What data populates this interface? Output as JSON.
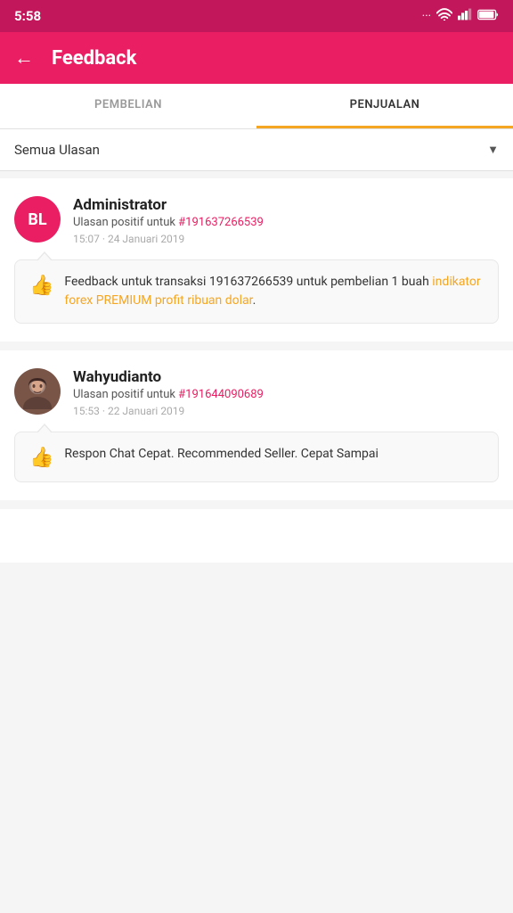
{
  "statusBar": {
    "time": "5:58",
    "icons": [
      "···",
      "wifi",
      "signal",
      "battery"
    ]
  },
  "header": {
    "backLabel": "←",
    "title": "Feedback"
  },
  "tabs": [
    {
      "id": "pembelian",
      "label": "PEMBELIAN",
      "active": false
    },
    {
      "id": "penjualan",
      "label": "PENJUALAN",
      "active": true
    }
  ],
  "filter": {
    "label": "Semua Ulasan",
    "arrowSymbol": "▼"
  },
  "feedbacks": [
    {
      "id": 1,
      "avatarType": "initials",
      "avatarText": "BL",
      "avatarBg": "#e91e63",
      "name": "Administrator",
      "subPrefix": "Ulasan positif untuk ",
      "orderLink": "#191637266539",
      "time": "15:07 · 24 Januari 2019",
      "comment": "Feedback untuk transaksi 191637266539 untuk pembelian 1 buah ",
      "commentLink": "indikator forex PREMIUM profit ribuan dolar",
      "commentSuffix": "."
    },
    {
      "id": 2,
      "avatarType": "photo",
      "avatarText": "",
      "avatarBg": "#795548",
      "name": "Wahyudianto",
      "subPrefix": "Ulasan positif untuk ",
      "orderLink": "#191644090689",
      "time": "15:53 · 22 Januari 2019",
      "comment": "Respon Chat Cepat. Recommended Seller. Cepat Sampai",
      "commentLink": "",
      "commentSuffix": ""
    }
  ]
}
